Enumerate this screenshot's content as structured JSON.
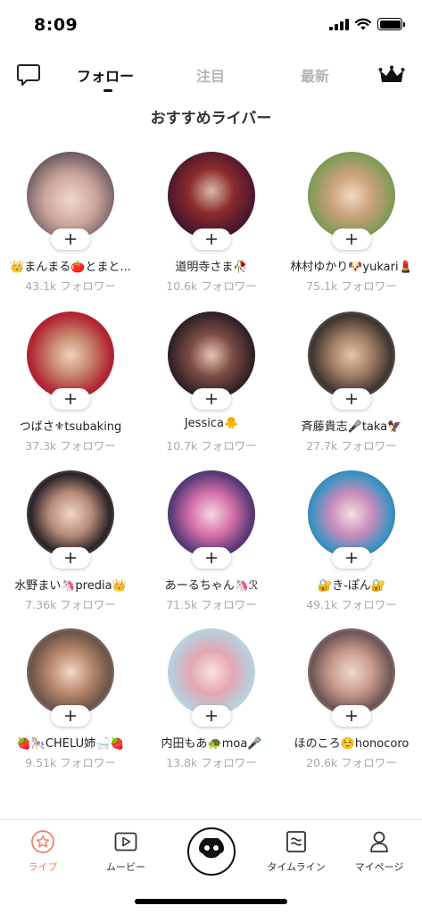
{
  "status_bar": {
    "time": "8:09"
  },
  "tabs": {
    "follow": "フォロー",
    "attention": "注目",
    "latest": "最新"
  },
  "section_title": "おすすめライバー",
  "liver_cards": [
    {
      "name": "👑まんまる🍅とまと...",
      "followers": "43.1k フォロワー"
    },
    {
      "name": "道明寺さま🥀",
      "followers": "10.6k フォロワー"
    },
    {
      "name": "林村ゆかり🐶yukari💄",
      "followers": "75.1k フォロワー"
    },
    {
      "name": "つばさ⚜tsubaking",
      "followers": "37.3k フォロワー"
    },
    {
      "name": "Jessica🐥",
      "followers": "10.7k フォロワー"
    },
    {
      "name": "斉藤貴志🎤taka🦅",
      "followers": "27.7k フォロワー"
    },
    {
      "name": "水野まい🦄predia👑",
      "followers": "7.36k フォロワー"
    },
    {
      "name": "あーるちゃん🦄ℛ",
      "followers": "71.5k フォロワー"
    },
    {
      "name": "🔐き-ぽん🔐",
      "followers": "49.1k フォロワー"
    },
    {
      "name": "🍓🎠CHELU姉🛁🍓",
      "followers": "9.51k フォロワー"
    },
    {
      "name": "内田もあ🐢moa🎤",
      "followers": "13.8k フォロワー"
    },
    {
      "name": "ほのころ☺️honocoro",
      "followers": "20.6k フォロワー"
    }
  ],
  "bottom_nav": {
    "live": "ライブ",
    "movie": "ムービー",
    "timeline": "タイムライン",
    "mypage": "マイページ"
  },
  "colors": {
    "accent": "#f0806b",
    "inactive_tab": "#b4b4b9",
    "follower_text": "#a8a8ae"
  }
}
